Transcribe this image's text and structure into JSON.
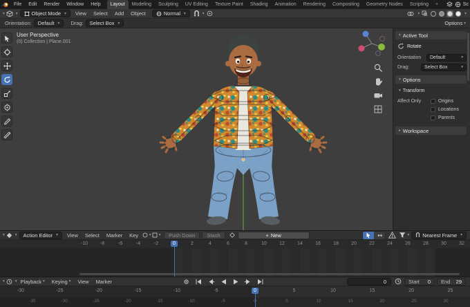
{
  "topbar": {
    "app_menus": [
      "File",
      "Edit",
      "Render",
      "Window",
      "Help"
    ],
    "tabs": [
      "Layout",
      "Modeling",
      "Sculpting",
      "UV Editing",
      "Texture Paint",
      "Shading",
      "Animation",
      "Rendering",
      "Compositing",
      "Geometry Nodes",
      "Scripting"
    ],
    "active_tab": "Layout",
    "add_tab": "+",
    "scene_short": "Sc"
  },
  "viewport_header": {
    "mode_value": "Object Mode",
    "menus": [
      "View",
      "Select",
      "Add",
      "Object"
    ],
    "orientation_value": "Normal"
  },
  "tool_settings": {
    "orientation_label": "Orientation:",
    "orientation_value": "Default",
    "drag_label": "Drag:",
    "drag_value": "Select Box",
    "options_label": "Options"
  },
  "viewport": {
    "view_label": "User Perspective",
    "collection_label": "(0) Collection | Plane.001"
  },
  "sidebar": {
    "active_tool": {
      "title": "Active Tool",
      "tool_name": "Rotate",
      "orientation_label": "Orientation",
      "orientation_value": "Default",
      "drag_label": "Drag:",
      "drag_value": "Select Box"
    },
    "options": {
      "title": "Options",
      "transform_title": "Transform",
      "affect_only_label": "Affect Only",
      "checkboxes": [
        {
          "label": "Origins",
          "checked": false
        },
        {
          "label": "Locations",
          "checked": false
        },
        {
          "label": "Parents",
          "checked": false
        }
      ]
    },
    "workspace_title": "Workspace"
  },
  "dopesheet": {
    "editor_value": "Action Editor",
    "menus": [
      "View",
      "Select",
      "Marker",
      "Key"
    ],
    "push_down_label": "Push Down",
    "stash_label": "Stash",
    "new_label": "New",
    "plus_glyph": "+",
    "snap_value": "Nearest Frame",
    "ruler_ticks": [
      -10,
      -8,
      -6,
      -4,
      -2,
      0,
      2,
      4,
      6,
      8,
      10,
      12,
      14,
      16,
      18,
      20,
      22,
      24,
      26,
      28,
      30,
      32
    ],
    "current_frame": 0
  },
  "timeline": {
    "playback_label": "Playback",
    "keying_label": "Keying",
    "menus": [
      "View",
      "Marker"
    ],
    "current_frame": 0,
    "start_label": "Start",
    "start_value": 0,
    "end_label": "End",
    "end_value": 29,
    "ruler_ticks": [
      -30,
      -25,
      -20,
      -15,
      -10,
      -5,
      0,
      5,
      10,
      15,
      20,
      25,
      30
    ],
    "sub_ruler_ticks": [
      -35,
      -30,
      -25,
      -20,
      -15,
      -10,
      -5,
      0,
      5,
      10,
      15,
      20,
      25,
      30
    ]
  },
  "colors": {
    "accent": "#4772b3",
    "topbar": "#1d1d1d",
    "header": "#323232",
    "viewport": "#3e3e3e",
    "panel": "#2e2e2e"
  }
}
